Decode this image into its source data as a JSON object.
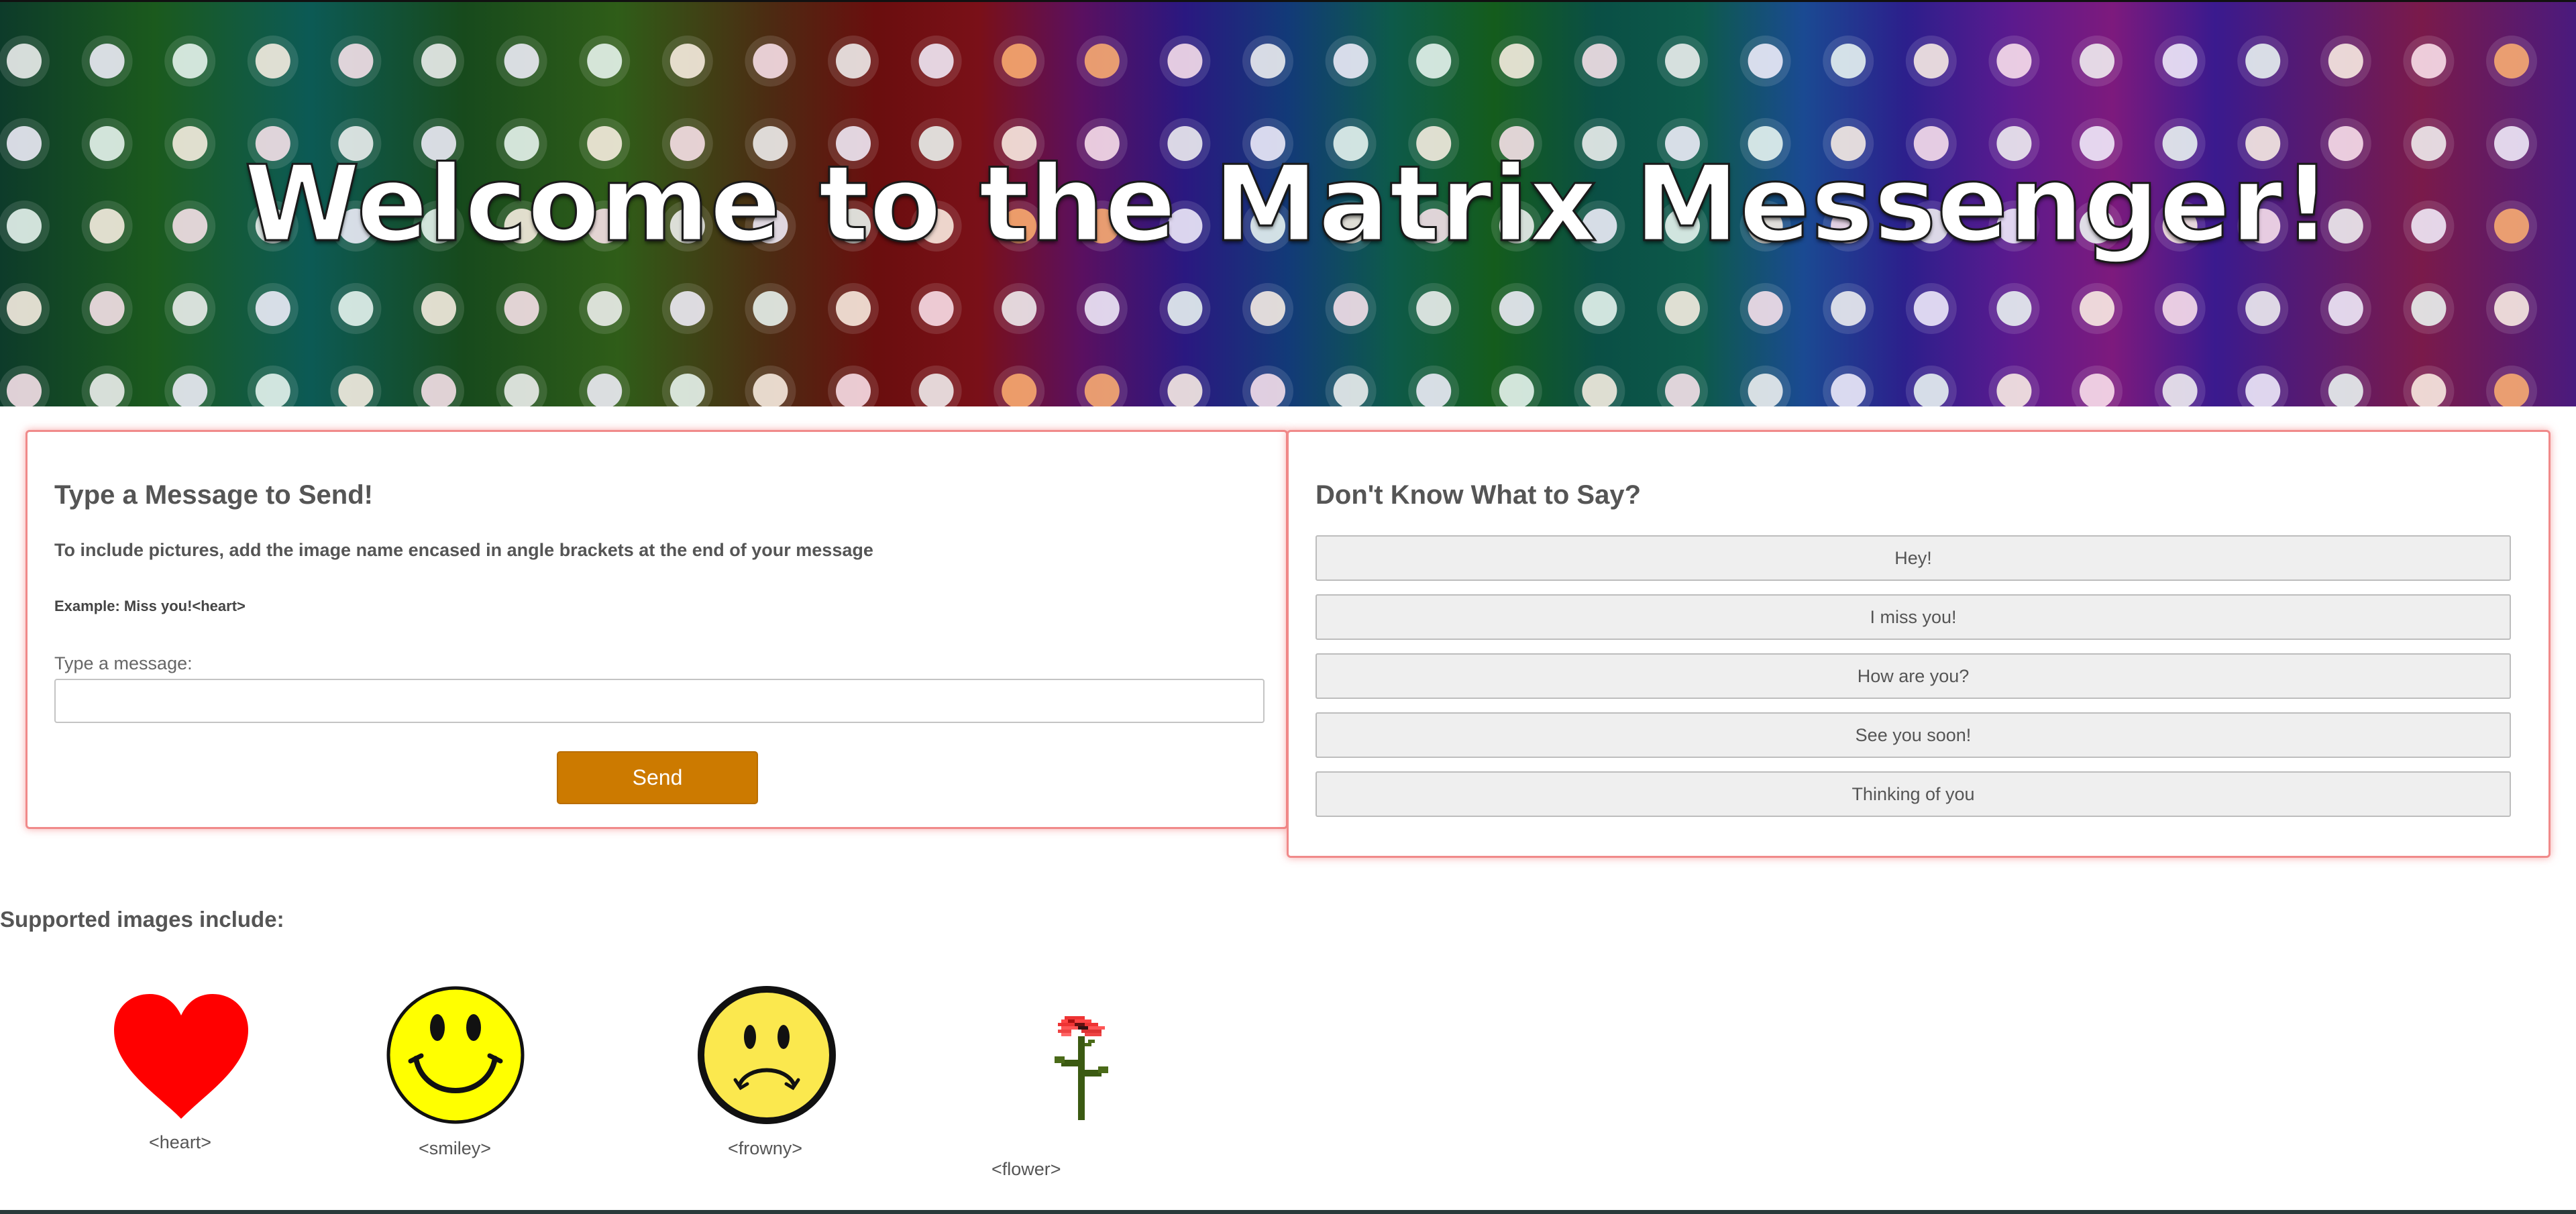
{
  "header": {
    "title": "Welcome to the Matrix Messenger!"
  },
  "compose": {
    "heading": "Type a Message to Send!",
    "instructions": "To include pictures, add the image name encased in angle brackets at the end of your message",
    "example": "Example: Miss you!<heart>",
    "input_label": "Type a message:",
    "input_value": "",
    "send_label": "Send"
  },
  "suggestions": {
    "heading": "Don't Know What to Say?",
    "items": [
      "Hey!",
      "I miss you!",
      "How are you?",
      "See you soon!",
      "Thinking of you"
    ]
  },
  "supported": {
    "heading": "Supported images include:",
    "images": [
      {
        "caption": "<heart>",
        "icon": "heart-icon"
      },
      {
        "caption": "<smiley>",
        "icon": "smiley-icon"
      },
      {
        "caption": "<frowny>",
        "icon": "frowny-icon"
      },
      {
        "caption": "<flower>",
        "icon": "flower-icon"
      }
    ]
  },
  "colors": {
    "accent": "#cc7a00",
    "panel_border": "#f08a8a",
    "heart": "#ff0000",
    "smiley": "#ffff00",
    "frowny": "#fbe84e"
  }
}
